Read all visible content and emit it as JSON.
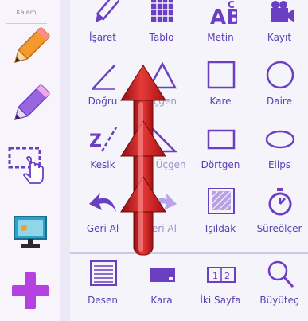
{
  "sidebar": {
    "title": "Kalem",
    "buttons": [
      {
        "name": "orange-pencil-icon",
        "color": "#f08a24"
      },
      {
        "name": "purple-pencil-icon",
        "color": "#8a55d6"
      },
      {
        "name": "selection-hand-icon",
        "color": "#6a3fc2"
      },
      {
        "name": "screen-share-icon",
        "color": "#1e8fb0"
      },
      {
        "name": "add-icon",
        "color": "#b640e0"
      }
    ]
  },
  "tools": {
    "row1": [
      "İşaret",
      "Tablo",
      "Metin",
      "Kayıt"
    ],
    "row2": [
      "Doğru",
      "Üçgen",
      "Kare",
      "Daire"
    ],
    "row3": [
      "Kesik",
      "Dik Üçgen",
      "Dörtgen",
      "Elips"
    ],
    "row4": [
      "Geri Al",
      "İleri Al",
      "Işıldak",
      "Süreölçer"
    ],
    "row5": [
      "Desen",
      "Kara",
      "İki Sayfa",
      "Büyüteç"
    ]
  },
  "colors": {
    "accent": "#5a3fb5",
    "icon": "#6a3fc2",
    "arrow": "#d41e1e"
  }
}
